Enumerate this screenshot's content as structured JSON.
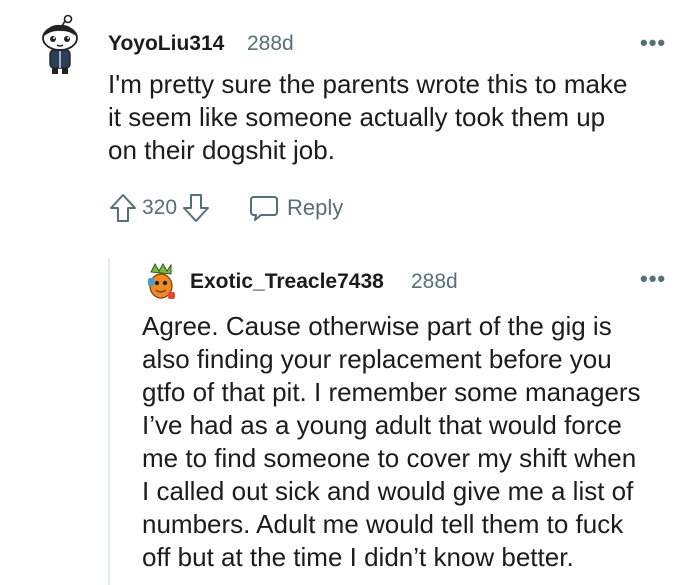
{
  "comments": [
    {
      "author": "YoyoLiu314",
      "age": "288d",
      "more": "•••",
      "lines": [
        "I'm pretty sure the parents wrote this to make",
        "it seem like someone actually took them up",
        "on their dogshit job."
      ],
      "score": "320",
      "reply_label": "Reply"
    },
    {
      "author": "Exotic_Treacle7438",
      "age": "288d",
      "more": "•••",
      "lines": [
        "Agree. Cause otherwise part of the gig is",
        "also finding your replacement before you",
        "gtfo of that pit. I remember some managers",
        "I’ve had as a young adult that would force",
        "me to find someone to cover my shift when",
        "I called out sick and would give me a list of",
        "numbers. Adult me would tell them to fuck",
        "off but at the time I didn’t know better."
      ]
    }
  ],
  "colors": {
    "text": "#1c1c1c",
    "meta": "#576f76",
    "thread": "#e5ebee"
  },
  "icons": [
    "user-avatar-icon",
    "upvote-icon",
    "downvote-icon",
    "comment-bubble-icon",
    "more-options-icon"
  ]
}
